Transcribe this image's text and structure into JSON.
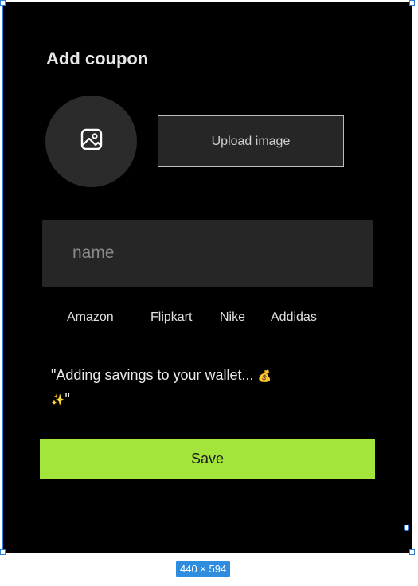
{
  "page": {
    "title": "Add coupon"
  },
  "image": {
    "icon": "image-icon",
    "upload_label": "Upload image"
  },
  "name_input": {
    "placeholder": "name",
    "value": ""
  },
  "brands": [
    "Amazon",
    "Flipkart",
    "Nike",
    "Addidas"
  ],
  "tagline": {
    "text": "\"Adding savings to your wallet...",
    "emoji_bag": "💰",
    "emoji_sparkles": "✨",
    "closing_quote": "\""
  },
  "save_label": "Save",
  "canvas": {
    "size_label": "440 × 594"
  },
  "colors": {
    "background": "#000000",
    "accent": "#a4e53b",
    "field": "#262626",
    "avatar": "#2b2b2b",
    "selection": "#2f8de0"
  }
}
